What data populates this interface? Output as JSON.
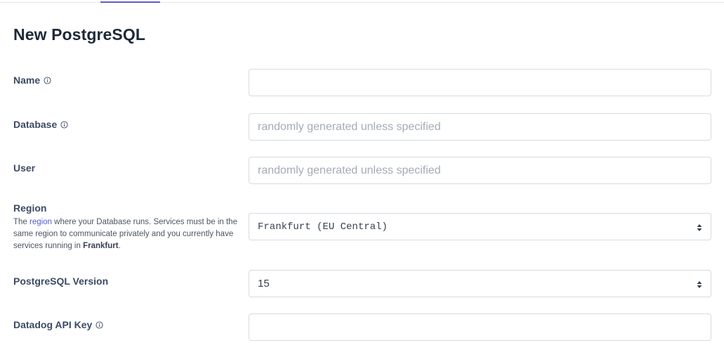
{
  "page": {
    "title": "New PostgreSQL"
  },
  "form": {
    "name": {
      "label": "Name",
      "value": "",
      "placeholder": ""
    },
    "database": {
      "label": "Database",
      "value": "",
      "placeholder": "randomly generated unless specified"
    },
    "user": {
      "label": "User",
      "value": "",
      "placeholder": "randomly generated unless specified"
    },
    "region": {
      "label": "Region",
      "help_prefix": "The ",
      "help_link": "region",
      "help_middle": " where your Database runs. Services must be in the same region to communicate privately and you currently have services running in ",
      "help_region": "Frankfurt",
      "help_suffix": ".",
      "selected": "Frankfurt (EU Central)"
    },
    "postgres_version": {
      "label": "PostgreSQL Version",
      "selected": "15"
    },
    "datadog_api_key": {
      "label": "Datadog API Key",
      "value": "",
      "placeholder": ""
    }
  },
  "icons": {
    "info": "info-circle-icon",
    "select_caret": "sort-caret-icon"
  },
  "colors": {
    "accent": "#5b5bd6",
    "link": "#4f5bd5",
    "label": "#3b4a63",
    "border": "#d6dae1",
    "placeholder": "#a4abb7"
  }
}
